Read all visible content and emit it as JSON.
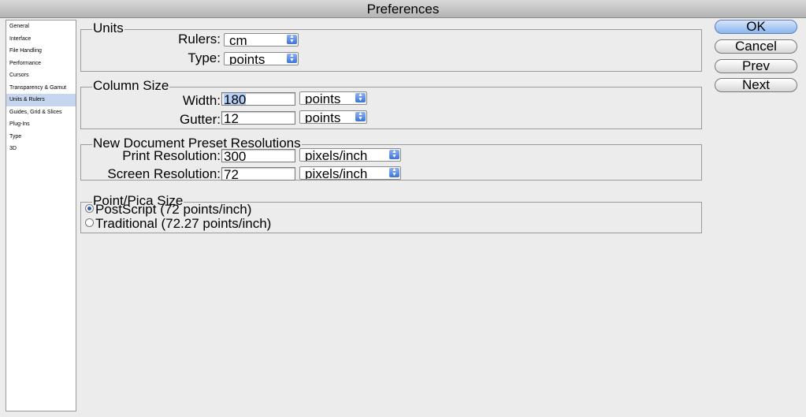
{
  "window": {
    "title": "Preferences"
  },
  "sidebar": {
    "items": [
      {
        "label": "General"
      },
      {
        "label": "Interface"
      },
      {
        "label": "File Handling"
      },
      {
        "label": "Performance"
      },
      {
        "label": "Cursors"
      },
      {
        "label": "Transparency & Gamut"
      },
      {
        "label": "Units & Rulers",
        "selected": true
      },
      {
        "label": "Guides, Grid & Slices"
      },
      {
        "label": "Plug-Ins"
      },
      {
        "label": "Type"
      },
      {
        "label": "3D"
      }
    ]
  },
  "units": {
    "title": "Units",
    "rulers_label": "Rulers:",
    "rulers_value": "cm",
    "type_label": "Type:",
    "type_value": "points"
  },
  "column_size": {
    "title": "Column Size",
    "width_label": "Width:",
    "width_value": "180",
    "width_unit": "points",
    "gutter_label": "Gutter:",
    "gutter_value": "12",
    "gutter_unit": "points"
  },
  "resolution": {
    "title": "New Document Preset Resolutions",
    "print_label": "Print Resolution:",
    "print_value": "300",
    "print_unit": "pixels/inch",
    "screen_label": "Screen Resolution:",
    "screen_value": "72",
    "screen_unit": "pixels/inch"
  },
  "point_pica": {
    "title": "Point/Pica Size",
    "postscript_label": "PostScript (72 points/inch)",
    "traditional_label": "Traditional (72.27 points/inch)",
    "selected": "postscript"
  },
  "buttons": {
    "ok": "OK",
    "cancel": "Cancel",
    "prev": "Prev",
    "next": "Next"
  }
}
